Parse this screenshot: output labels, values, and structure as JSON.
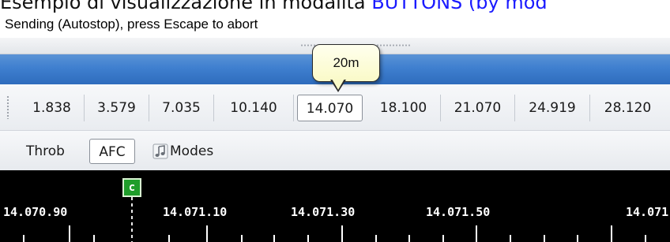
{
  "caption": {
    "text": "Esempio di visualizzazione in modalità",
    "link": "BUTTONS (by mod"
  },
  "status": {
    "text": "Sending (Autostop), press Escape to abort"
  },
  "band_tooltip": {
    "text": "20m"
  },
  "frequency_buttons": [
    {
      "label": "1.838"
    },
    {
      "label": "3.579"
    },
    {
      "label": "7.035"
    },
    {
      "label": "10.140"
    },
    {
      "label": "14.070",
      "selected": true
    },
    {
      "label": "18.100"
    },
    {
      "label": "21.070"
    },
    {
      "label": "24.919"
    },
    {
      "label": "28.120"
    }
  ],
  "mode_bar": {
    "throb": "Throb",
    "afc": "AFC",
    "modes": "Modes",
    "modes_icon": "music-note-icon"
  },
  "waterfall": {
    "marker_label": "c",
    "scale_labels": [
      "14.070.90",
      "14.071.10",
      "14.071.30",
      "14.071.50",
      "14.071"
    ]
  },
  "colors": {
    "band_blue": "#3f7fcf",
    "marker_green": "#1f9d2a",
    "link_blue": "#1a1aff",
    "tooltip_yellow": "#fafac8"
  }
}
